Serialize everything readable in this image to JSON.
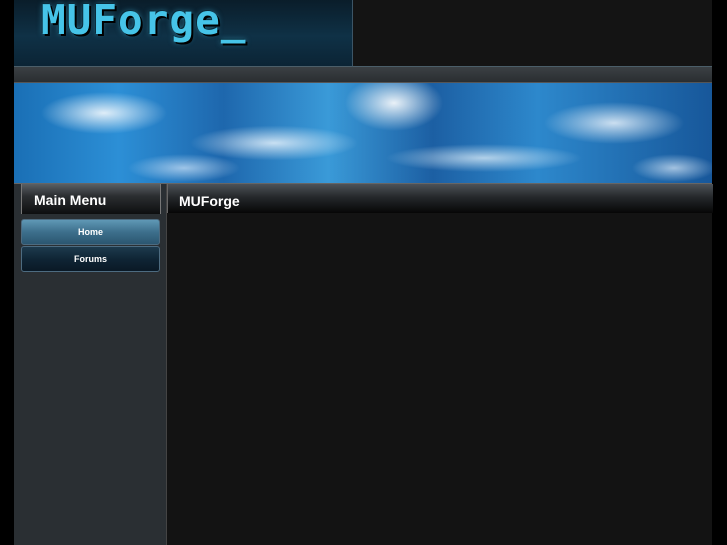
{
  "header": {
    "logo_text": "MUForge_"
  },
  "sidebar": {
    "title": "Main Menu",
    "items": [
      {
        "label": "Home",
        "active": true
      },
      {
        "label": "Forums",
        "active": false
      }
    ]
  },
  "main": {
    "title": "MUForge"
  },
  "colors": {
    "accent": "#46c4e8",
    "background": "#111111",
    "sidebar": "#2a2f33"
  }
}
